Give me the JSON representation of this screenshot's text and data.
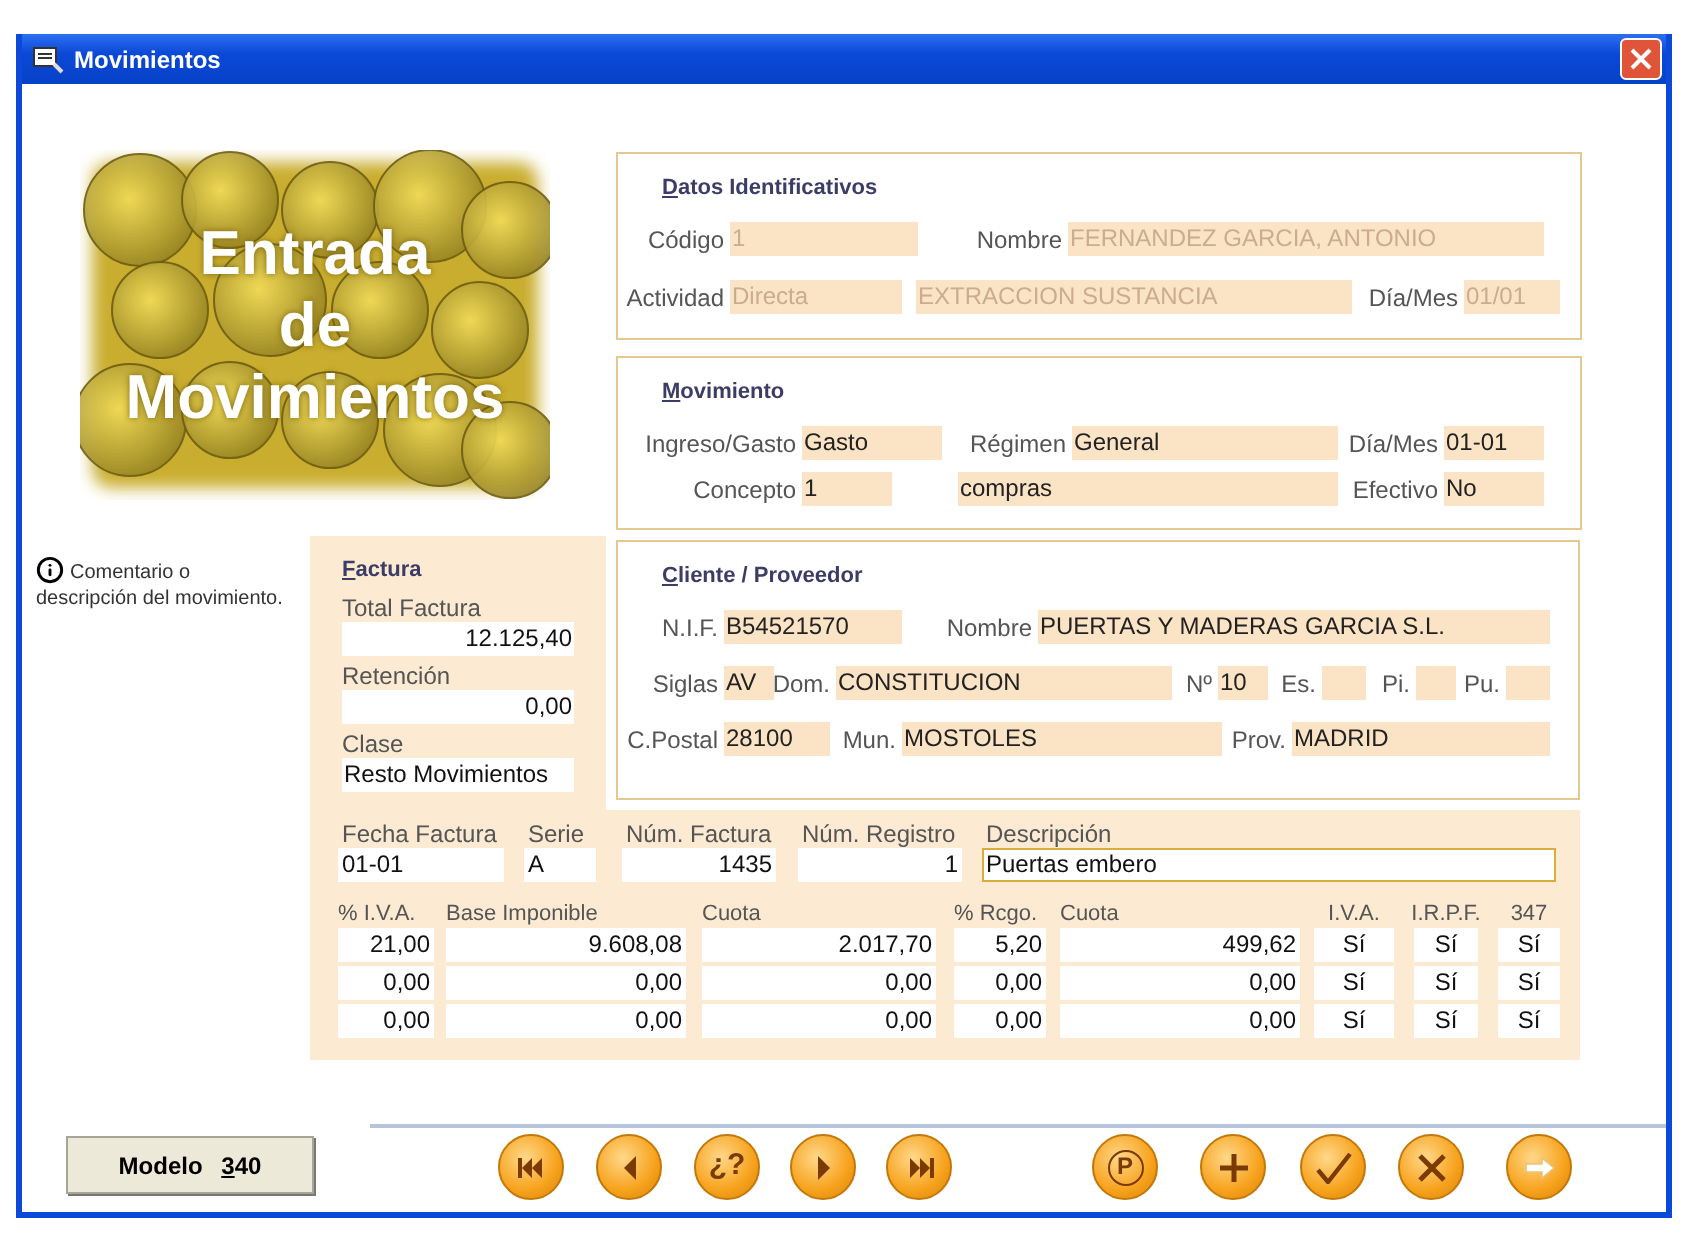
{
  "window": {
    "title": "Movimientos"
  },
  "banner": [
    "Entrada",
    "de",
    "Movimientos"
  ],
  "comment": "Comentario o descripción del movimiento.",
  "datos": {
    "title": "Datos Identificativos",
    "disabled": true,
    "rows": [
      [
        {
          "label": "Código",
          "value": "1"
        },
        {
          "label": "Nombre",
          "value": "FERNANDEZ GARCIA, ANTONIO"
        }
      ],
      [
        {
          "label": "Actividad",
          "value": "Directa"
        },
        {
          "value": "EXTRACCION SUSTANCIA"
        },
        {
          "label": "Día/Mes",
          "value": "01/01"
        }
      ]
    ]
  },
  "movimiento": {
    "title": "Movimiento",
    "disabled": false,
    "rows": [
      [
        {
          "label": "Ingreso/Gasto",
          "value": "Gasto"
        },
        {
          "label": "Régimen",
          "value": "General"
        },
        {
          "label": "Día/Mes",
          "value": "01-01"
        }
      ],
      [
        {
          "label": "Concepto",
          "value": "1"
        },
        {
          "value": "compras"
        },
        {
          "label": "Efectivo",
          "value": "No"
        }
      ]
    ]
  },
  "cliente": {
    "title": "Cliente / Proveedor",
    "disabled": false,
    "rows": [
      [
        {
          "label": "N.I.F.",
          "value": "B54521570"
        },
        {
          "label": "Nombre",
          "value": "PUERTAS Y MADERAS GARCIA S.L."
        }
      ],
      [
        {
          "label": "Siglas",
          "value": "AV"
        },
        {
          "label": "Dom.",
          "value": "CONSTITUCION"
        },
        {
          "label": "Nº",
          "value": "10"
        },
        {
          "label": "Es."
        },
        {
          "label": "Pi."
        },
        {
          "label": "Pu."
        }
      ],
      [
        {
          "label": "C.Postal",
          "value": "28100"
        },
        {
          "label": "Mun.",
          "value": "MOSTOLES"
        },
        {
          "label": "Prov.",
          "value": "MADRID"
        }
      ]
    ]
  },
  "factura": {
    "title": "Factura",
    "fields": [
      {
        "label": "Total Factura",
        "value": "12.125,40"
      },
      {
        "label": "Retención",
        "value": "0,00"
      },
      {
        "label": "Clase",
        "value": "Resto Movimientos"
      }
    ]
  },
  "invoice_fields": [
    {
      "label": "Fecha Factura",
      "value": "01-01",
      "focused": false
    },
    {
      "label": "Serie",
      "value": "A",
      "focused": false
    },
    {
      "label": "Núm. Factura",
      "value": "1435",
      "focused": false
    },
    {
      "label": "Núm. Registro",
      "value": "1",
      "focused": false
    },
    {
      "label": "Descripción",
      "value": "Puertas embero",
      "focused": true
    }
  ],
  "tax_table": {
    "columns": [
      "% I.V.A.",
      "Base Imponible",
      "Cuota",
      "% Rcgo.",
      "Cuota",
      "I.V.A.",
      "I.R.P.F.",
      "347"
    ],
    "rows": [
      [
        "21,00",
        "9.608,08",
        "2.017,70",
        "5,20",
        "499,62",
        "Sí",
        "Sí",
        "Sí"
      ],
      [
        "0,00",
        "0,00",
        "0,00",
        "0,00",
        "0,00",
        "Sí",
        "Sí",
        "Sí"
      ],
      [
        "0,00",
        "0,00",
        "0,00",
        "0,00",
        "0,00",
        "Sí",
        "Sí",
        "Sí"
      ]
    ]
  },
  "modelo_button": {
    "label": "Modelo",
    "number": "340"
  },
  "nav_buttons": [
    {
      "kind": "first"
    },
    {
      "kind": "previous"
    },
    {
      "kind": "text",
      "label": "¿?"
    },
    {
      "kind": "next"
    },
    {
      "kind": "last"
    },
    {
      "kind": "circled",
      "label": "P"
    },
    {
      "kind": "add"
    },
    {
      "kind": "accept"
    },
    {
      "kind": "cancel"
    },
    {
      "kind": "exit"
    }
  ]
}
